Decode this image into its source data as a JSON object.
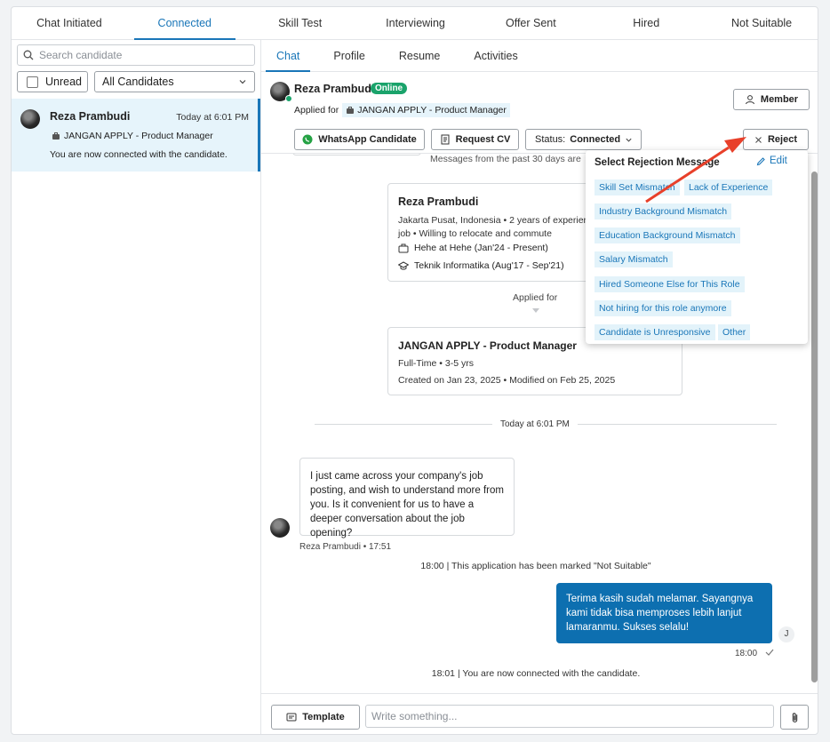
{
  "pipeline_tabs": [
    "Chat Initiated",
    "Connected",
    "Skill Test",
    "Interviewing",
    "Offer Sent",
    "Hired",
    "Not Suitable"
  ],
  "search": {
    "placeholder": "Search candidate"
  },
  "filters": {
    "unread_label": "Unread",
    "select_value": "All Candidates"
  },
  "candidate_list": [
    {
      "name": "Reza Prambudi",
      "time": "Today at 6:01 PM",
      "job": "JANGAN APPLY - Product Manager",
      "last_message": "You are now connected with the candidate."
    }
  ],
  "sub_tabs": [
    "Chat",
    "Profile",
    "Resume",
    "Activities"
  ],
  "header": {
    "name": "Reza Prambudi",
    "online_label": "Online",
    "applied_for_label": "Applied for",
    "job": "JANGAN APPLY - Product Manager",
    "member_label": "Member",
    "whatsapp_label": "WhatsApp Candidate",
    "request_cv_label": "Request CV",
    "status_label": "Status:",
    "status_value": "Connected",
    "reject_label": "Reject"
  },
  "chat": {
    "past_note": "Messages from the past 30 days are",
    "profile": {
      "name": "Reza Prambudi",
      "meta": "Jakarta Pusat, Indonesia • 2 years of experience",
      "meta2": "job • Willing to relocate and commute",
      "work": "Hehe at Hehe (Jan'24 - Present)",
      "education": "Teknik Informatika (Aug'17 - Sep'21)"
    },
    "applied_for": "Applied for",
    "job_card": {
      "title": "JANGAN APPLY - Product Manager",
      "meta": "Full-Time • 3-5 yrs",
      "dates": "Created on Jan 23, 2025 • Modified on Feb 25, 2025"
    },
    "divider": "Today at 6:01 PM",
    "incoming": {
      "text": "I just came across your company's job posting, and wish to understand more from you. Is it convenient for us to have a deeper conversation about the job opening?",
      "meta": "Reza Prambudi • 17:51"
    },
    "system1": "18:00 | This application has been marked \"Not Suitable\"",
    "outgoing": {
      "text": "Terima kasih sudah melamar. Sayangnya kami tidak bisa memproses lebih lanjut lamaranmu. Sukses selalu!",
      "meta": "18:00",
      "avatar": "J"
    },
    "system2": "18:01 | You are now connected with the candidate."
  },
  "composer": {
    "template_label": "Template",
    "placeholder": "Write something..."
  },
  "rejection_popup": {
    "title": "Select Rejection Message",
    "edit_label": "Edit",
    "options": [
      "Skill Set Mismatch",
      "Lack of Experience",
      "Industry Background Mismatch",
      "Education Background Mismatch",
      "Salary Mismatch",
      "Hired Someone Else for This Role",
      "Not hiring for this role anymore",
      "Candidate is Unresponsive",
      "Other"
    ]
  },
  "colors": {
    "accent": "#1976b8",
    "online": "#1aa36b",
    "outgoing_bubble": "#0d6fb0",
    "annotation_arrow": "#e8402a"
  }
}
